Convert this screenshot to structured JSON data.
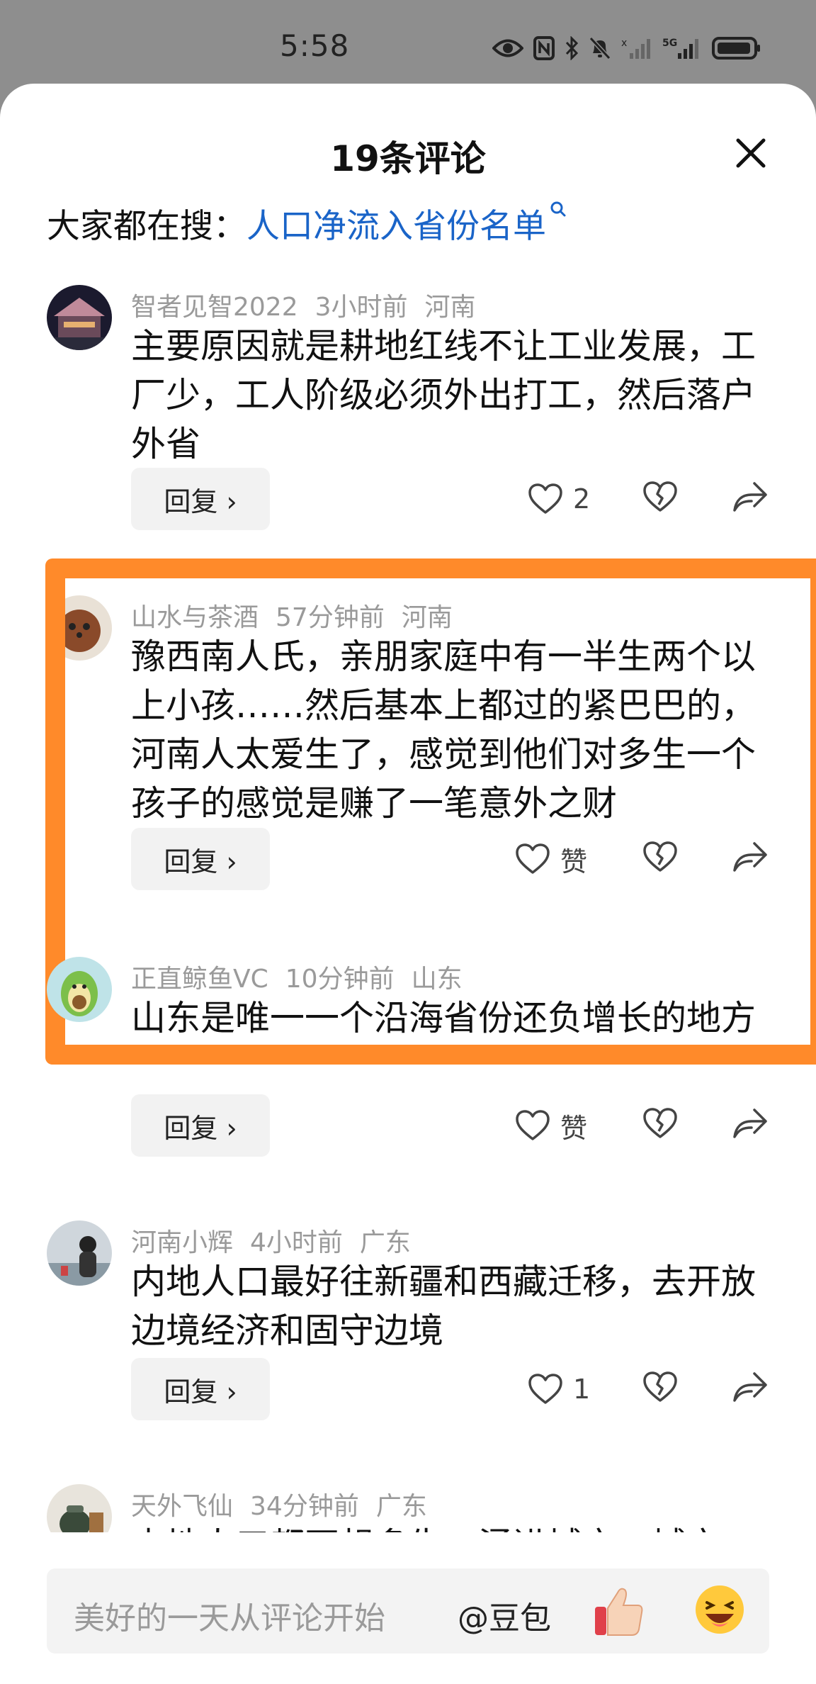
{
  "status_bar": {
    "time": "5:58",
    "network_label": "5G"
  },
  "sheet": {
    "title": "19条评论",
    "search_prefix": "大家都在搜：",
    "search_term": "人口净流入省份名单"
  },
  "comments": [
    {
      "user": "智者见智2022",
      "time": "3小时前",
      "region": "河南",
      "text": "主要原因就是耕地红线不让工业发展，工厂少，工人阶级必须外出打工，然后落户外省",
      "reply_label": "回复 ›",
      "like_label": "2"
    },
    {
      "user": "山水与茶酒",
      "time": "57分钟前",
      "region": "河南",
      "text": "豫西南人氏，亲朋家庭中有一半生两个以上小孩……然后基本上都过的紧巴巴的，河南人太爱生了，感觉到他们对多生一个孩子的感觉是赚了一笔意外之财",
      "reply_label": "回复 ›",
      "like_label": "赞"
    },
    {
      "user": "正直鲸鱼VC",
      "time": "10分钟前",
      "region": "山东",
      "text": "山东是唯一一个沿海省份还负增长的地方",
      "reply_label": "回复 ›",
      "like_label": "赞"
    },
    {
      "user": "河南小辉",
      "time": "4小时前",
      "region": "广东",
      "text": "内地人口最好往新疆和西藏迁移，去开放边境经济和固守边境",
      "reply_label": "回复 ›",
      "like_label": "1"
    },
    {
      "user": "天外飞仙",
      "time": "34分钟前",
      "region": "广东",
      "text": "内地人口都不想多生，涌进城市，城市"
    }
  ],
  "input": {
    "placeholder": "美好的一天从评论开始",
    "mention": "@豆包"
  },
  "colors": {
    "link": "#1a64c8",
    "highlight": "#ff8a2a",
    "meta": "#9a9a9a"
  }
}
